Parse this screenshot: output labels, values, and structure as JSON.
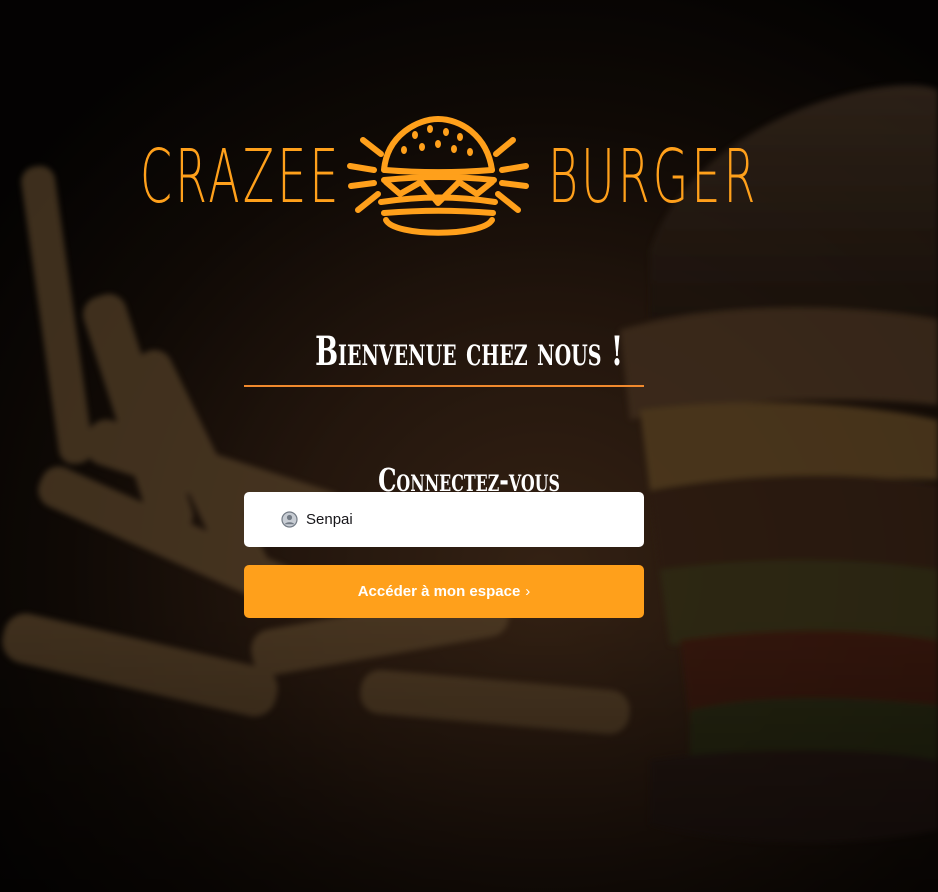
{
  "logo": {
    "left_word": "CRAZEE",
    "right_word": "BURGER",
    "icon": "burger-icon",
    "color": "#ffa01b"
  },
  "welcome": {
    "heading": "Bienvenue chez nous !",
    "divider_color": "#f0892d"
  },
  "login": {
    "subheading": "Connectez-vous",
    "username_icon": "user-circle-icon",
    "username_value": "Senpai",
    "submit_label": "Accéder à mon espace",
    "submit_icon": "chevron-right-icon",
    "submit_chevron": "›",
    "accent": "#ffa01b"
  },
  "background": {
    "image": "burger-and-fries-photo"
  }
}
